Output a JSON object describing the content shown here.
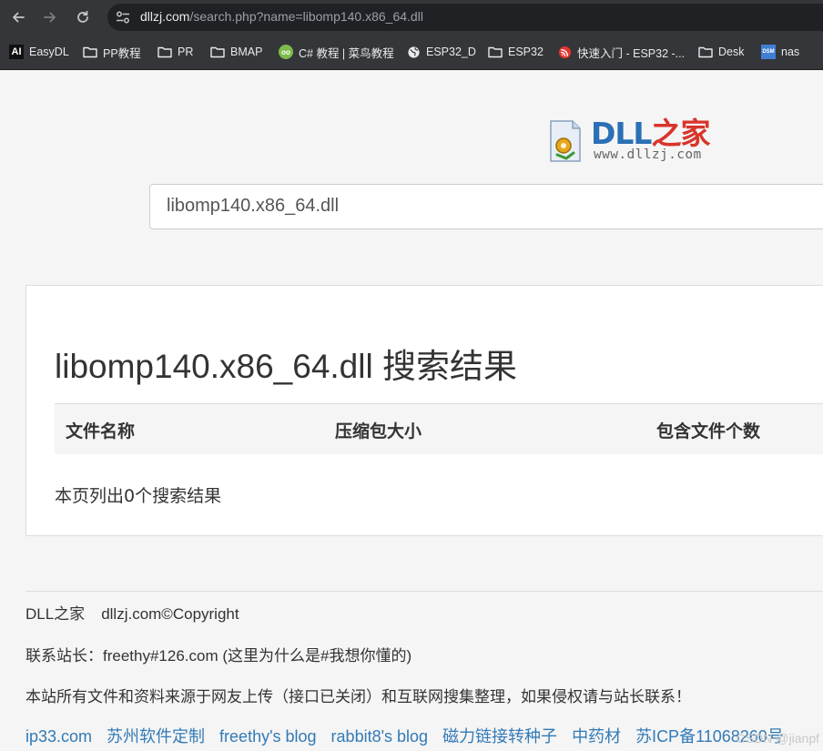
{
  "browser": {
    "url_host": "dllzj.com",
    "url_path": "/search.php?name=libomp140.x86_64.dll"
  },
  "bookmarks": [
    {
      "label": "EasyDL",
      "icon": "ai-logo-icon"
    },
    {
      "label": "PP教程",
      "icon": "folder-icon"
    },
    {
      "label": "PR",
      "icon": "folder-icon"
    },
    {
      "label": "BMAP",
      "icon": "folder-icon"
    },
    {
      "label": "C# 教程 | 菜鸟教程",
      "icon": "runoob-icon"
    },
    {
      "label": "ESP32_D",
      "icon": "globe-icon"
    },
    {
      "label": "ESP32",
      "icon": "folder-icon"
    },
    {
      "label": "快速入门 - ESP32 -...",
      "icon": "espressif-icon"
    },
    {
      "label": "Desk",
      "icon": "folder-icon"
    },
    {
      "label": "nas",
      "icon": "dsm-icon"
    }
  ],
  "logo": {
    "text_dll": "DLL",
    "text_cn": "之家",
    "subtitle": "www.dllzj.com",
    "colors": {
      "blue": "#2b6fb6",
      "red": "#d9342b"
    }
  },
  "search": {
    "value": "libomp140.x86_64.dll"
  },
  "results": {
    "title": "libomp140.x86_64.dll 搜索结果",
    "columns": [
      "文件名称",
      "压缩包大小",
      "包含文件个数"
    ],
    "count_text": "本页列出0个搜索结果"
  },
  "footer": {
    "line1_name": "DLL之家",
    "line1_copy": "dllzj.com©Copyright",
    "line2": "联系站长：freethy#126.com (这里为什么是#我想你懂的)",
    "line3": "本站所有文件和资料来源于网友上传（接口已关闭）和互联网搜集整理，如果侵权请与站长联系！",
    "links": [
      "ip33.com",
      "苏州软件定制",
      "freethy's blog",
      "rabbit8's blog",
      "磁力链接转种子",
      "中药材",
      "苏ICP备11068260号"
    ],
    "link_color": "#337ab7"
  },
  "watermark": "CSDN @jianpf"
}
